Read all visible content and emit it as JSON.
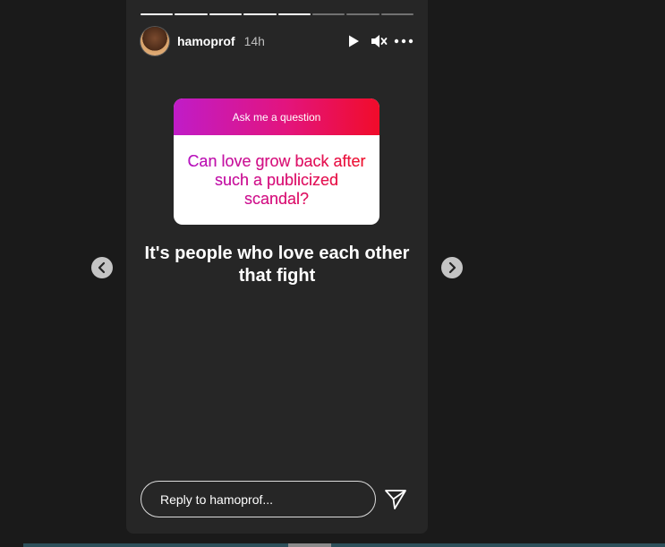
{
  "story": {
    "progress": {
      "total_segments": 8,
      "completed_segments": 5
    },
    "header": {
      "username": "hamoprof",
      "time": "14h",
      "icons": [
        "play-icon",
        "mute-icon",
        "more-icon"
      ]
    },
    "question_card": {
      "title": "Ask me a question",
      "question": "Can love grow back after such a publicized scandal?",
      "gradient_colors": [
        "#c01cc8",
        "#e3147d",
        "#f10c2a"
      ]
    },
    "caption": "It's people who love each other that fight",
    "reply": {
      "placeholder": "Reply to hamoprof..."
    }
  },
  "navigation": {
    "prev_icon": "chevron-left-icon",
    "next_icon": "chevron-right-icon"
  },
  "colors": {
    "background": "#1a1a1a",
    "story_background": "#262626",
    "text": "#ffffff"
  }
}
